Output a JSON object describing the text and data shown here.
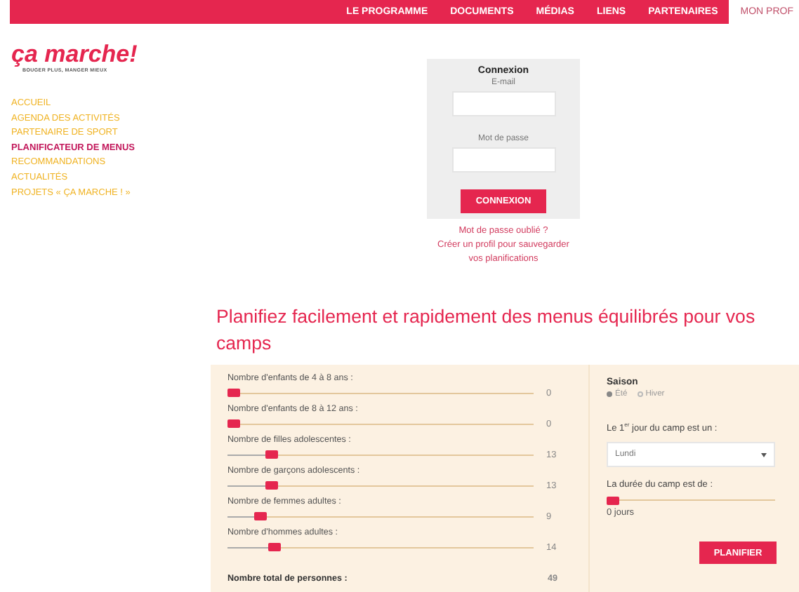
{
  "top_nav": [
    {
      "label": "LE PROGRAMME",
      "selected": false
    },
    {
      "label": "DOCUMENTS",
      "selected": false
    },
    {
      "label": "MÉDIAS",
      "selected": false
    },
    {
      "label": "LIENS",
      "selected": false
    },
    {
      "label": "PARTENAIRES",
      "selected": false
    },
    {
      "label": "MON PROF",
      "selected": true
    }
  ],
  "logo": {
    "title": "ça marche!",
    "tagline": "BOUGER PLUS, MANGER MIEUX"
  },
  "sidebar": {
    "items": [
      {
        "label": "ACCUEIL",
        "selected": false
      },
      {
        "label": "AGENDA DES ACTIVITÉS",
        "selected": false
      },
      {
        "label": "PARTENAIRE DE SPORT",
        "selected": false
      },
      {
        "label": "PLANIFICATEUR DE MENUS",
        "selected": true
      },
      {
        "label": "RECOMMANDATIONS",
        "selected": false
      },
      {
        "label": "ACTUALITÉS",
        "selected": false
      },
      {
        "label": "PROJETS « ÇA MARCHE ! »",
        "selected": false
      }
    ]
  },
  "login": {
    "title": "Connexion",
    "email_label": "E-mail",
    "password_label": "Mot de passe",
    "button": "CONNEXION",
    "forgot_link": "Mot de passe oublié ?",
    "create_link": "Créer un profil pour sauvegarder vos planifications"
  },
  "heading": "Planifiez facilement et rapidement des menus équilibrés pour vos camps",
  "planner": {
    "counts": [
      {
        "label": "Nombre d'enfants de 4 à 8 ans :",
        "level": 0,
        "reading": "0"
      },
      {
        "label": "Nombre d'enfants de 8 à 12 ans :",
        "level": 0,
        "reading": "0"
      },
      {
        "label": "Nombre de filles adolescentes :",
        "level": 0.13,
        "reading": "13"
      },
      {
        "label": "Nombre de garçons adolescents :",
        "level": 0.13,
        "reading": "13"
      },
      {
        "label": "Nombre de femmes adultes :",
        "level": 0.09,
        "reading": "9"
      },
      {
        "label": "Nombre d'hommes adultes :",
        "level": 0.14,
        "reading": "14"
      }
    ],
    "total_label": "Nombre total de personnes :",
    "total": "49",
    "season_label": "Saison",
    "seasons": [
      {
        "label": "Été",
        "selected": true
      },
      {
        "label": "Hiver",
        "selected": false
      }
    ],
    "first_day_label": "Le 1$^{er}$ jour du camp est un :",
    "first_day": "Lundi",
    "duration": {
      "label": "La durée du camp est de :",
      "level": 0,
      "reading": "0 jours"
    },
    "button": "PLANIFIER"
  }
}
